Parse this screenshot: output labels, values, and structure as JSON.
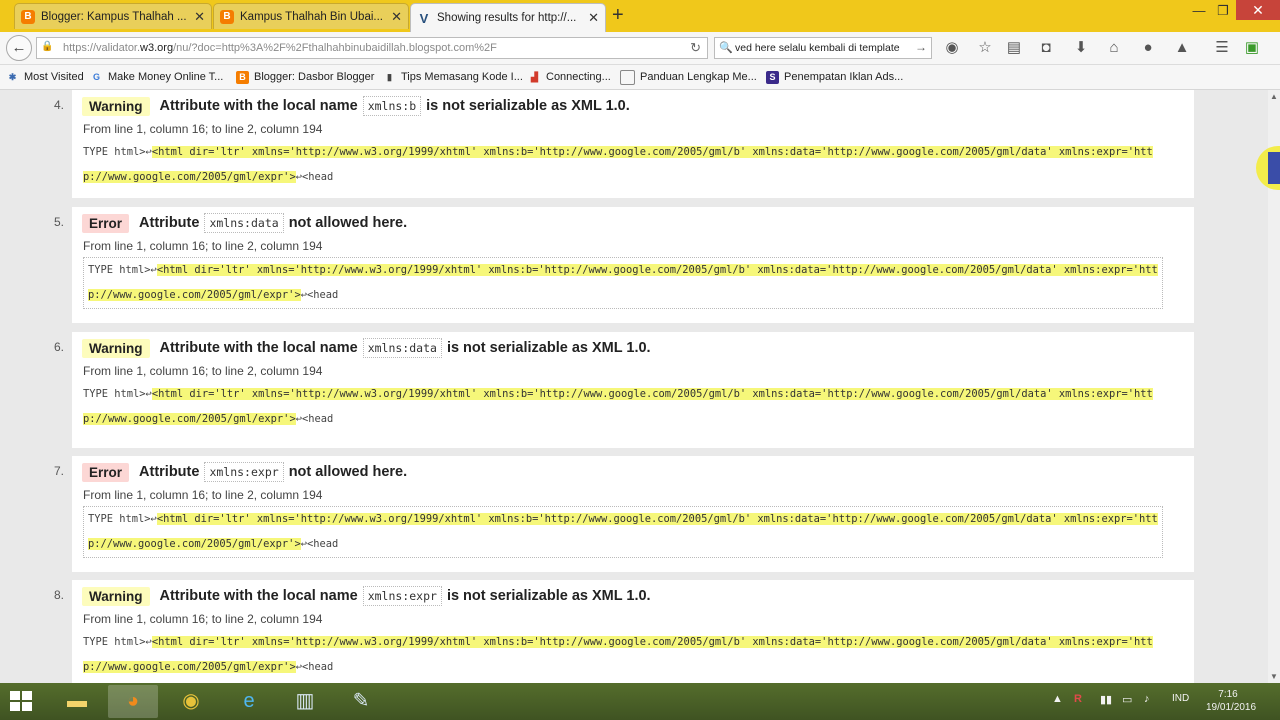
{
  "browser": {
    "tabs": [
      {
        "label": "Blogger: Kampus Thalhah ...",
        "icon": "blogger-icon",
        "active": false
      },
      {
        "label": "Kampus Thalhah Bin Ubai...",
        "icon": "blogger-icon",
        "active": false
      },
      {
        "label": "Showing results for http://...",
        "icon": "validator-icon",
        "active": true
      }
    ],
    "address": {
      "prefix": "https://validator.",
      "host": "w3.org",
      "suffix": "/nu/?doc=http%3A%2F%2Fthalhahbinubaidillah.blogspot.com%2F"
    },
    "search": {
      "value": "ved here selalu kembali di template"
    },
    "bookmarks": [
      {
        "label": "Most Visited",
        "icon": "star-icon"
      },
      {
        "label": "Make Money Online T...",
        "icon": "google-icon"
      },
      {
        "label": "Blogger: Dasbor Blogger",
        "icon": "blogger-icon"
      },
      {
        "label": "Tips Memasang Kode I...",
        "icon": "bookmark-icon"
      },
      {
        "label": "Connecting...",
        "icon": "chart-icon"
      },
      {
        "label": "Panduan Lengkap Me...",
        "icon": "page-icon"
      },
      {
        "label": "Penempatan Iklan Ads...",
        "icon": "s-icon"
      }
    ]
  },
  "messages": [
    {
      "num": "4.",
      "type": "Warning",
      "pre": "Attribute with the local name",
      "code": "xmlns:b",
      "post": "is not serializable as XML 1.0.",
      "loc": "From line 1, column 16; to line 2, column 194",
      "ext_pre": "TYPE html>↩",
      "ext_mark": "<html dir='ltr' xmlns='http://www.w3.org/1999/xhtml' xmlns:b='http://www.google.com/2005/gml/b' xmlns:data='http://www.google.com/2005/gml/data' xmlns:expr='http://www.google.com/2005/gml/expr'>",
      "ext_post": "↩<head"
    },
    {
      "num": "5.",
      "type": "Error",
      "pre": "Attribute",
      "code": "xmlns:data",
      "post": "not allowed here.",
      "loc": "From line 1, column 16; to line 2, column 194",
      "ext_pre": "TYPE html>↩",
      "ext_mark": "<html dir='ltr' xmlns='http://www.w3.org/1999/xhtml' xmlns:b='http://www.google.com/2005/gml/b' xmlns:data='http://www.google.com/2005/gml/data' xmlns:expr='http://www.google.com/2005/gml/expr'>",
      "ext_post": "↩<head"
    },
    {
      "num": "6.",
      "type": "Warning",
      "pre": "Attribute with the local name",
      "code": "xmlns:data",
      "post": "is not serializable as XML 1.0.",
      "loc": "From line 1, column 16; to line 2, column 194",
      "ext_pre": "TYPE html>↩",
      "ext_mark": "<html dir='ltr' xmlns='http://www.w3.org/1999/xhtml' xmlns:b='http://www.google.com/2005/gml/b' xmlns:data='http://www.google.com/2005/gml/data' xmlns:expr='http://www.google.com/2005/gml/expr'>",
      "ext_post": "↩<head"
    },
    {
      "num": "7.",
      "type": "Error",
      "pre": "Attribute",
      "code": "xmlns:expr",
      "post": "not allowed here.",
      "loc": "From line 1, column 16; to line 2, column 194",
      "ext_pre": "TYPE html>↩",
      "ext_mark": "<html dir='ltr' xmlns='http://www.w3.org/1999/xhtml' xmlns:b='http://www.google.com/2005/gml/b' xmlns:data='http://www.google.com/2005/gml/data' xmlns:expr='http://www.google.com/2005/gml/expr'>",
      "ext_post": "↩<head"
    },
    {
      "num": "8.",
      "type": "Warning",
      "pre": "Attribute with the local name",
      "code": "xmlns:expr",
      "post": "is not serializable as XML 1.0.",
      "loc": "From line 1, column 16; to line 2, column 194",
      "ext_pre": "TYPE html>↩",
      "ext_mark": "<html dir='ltr' xmlns='http://www.w3.org/1999/xhtml' xmlns:b='http://www.google.com/2005/gml/b' xmlns:data='http://www.google.com/2005/gml/data' xmlns:expr='http://www.google.com/2005/gml/expr'>",
      "ext_post": "↩<head"
    }
  ],
  "taskbar": {
    "apps": [
      "file-explorer-icon",
      "firefox-icon",
      "chrome-icon",
      "internet-explorer-icon",
      "app-icon",
      "paint-icon"
    ],
    "lang": "IND",
    "time": "7:16",
    "date": "19/01/2016"
  },
  "colors": {
    "titlebar": "#f0c81b",
    "warning_bg": "#fdfcbc",
    "error_bg": "#fcd7d5",
    "highlight": "#f6f77a"
  }
}
